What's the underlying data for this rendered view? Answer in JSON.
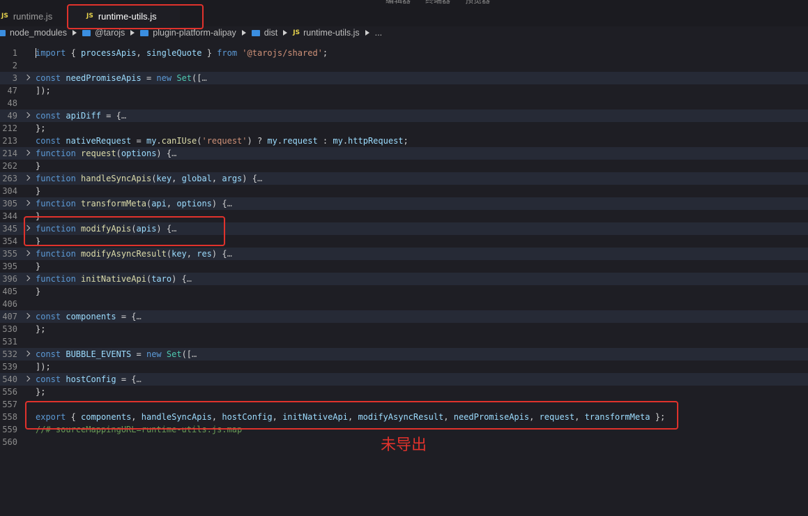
{
  "menu": [
    "编辑器",
    "终端器",
    "预览器"
  ],
  "tabs": [
    {
      "icon": "JS",
      "label": "runtime.js",
      "active": false
    },
    {
      "icon": "JS",
      "label": "runtime-utils.js",
      "active": true
    }
  ],
  "breadcrumb": [
    "node_modules",
    "@tarojs",
    "plugin-platform-alipay",
    "dist",
    "runtime-utils.js",
    "..."
  ],
  "file_icon_label": "JS",
  "lines": [
    {
      "n": "1",
      "fold": false,
      "hl": false,
      "tokens": [
        [
          "kw",
          "import"
        ],
        [
          "pl",
          " { "
        ],
        [
          "var",
          "processApis"
        ],
        [
          "pl",
          ", "
        ],
        [
          "var",
          "singleQuote"
        ],
        [
          "pl",
          " } "
        ],
        [
          "kw",
          "from"
        ],
        [
          "pl",
          " "
        ],
        [
          "str",
          "'@tarojs/shared'"
        ],
        [
          "pl",
          ";"
        ]
      ]
    },
    {
      "n": "2",
      "fold": false,
      "hl": false,
      "tokens": []
    },
    {
      "n": "3",
      "fold": true,
      "hl": true,
      "tokens": [
        [
          "kw",
          "const"
        ],
        [
          "pl",
          " "
        ],
        [
          "var",
          "needPromiseApis"
        ],
        [
          "pl",
          " = "
        ],
        [
          "kw",
          "new"
        ],
        [
          "pl",
          " "
        ],
        [
          "cls",
          "Set"
        ],
        [
          "pl",
          "(["
        ],
        [
          "ell",
          "…"
        ]
      ]
    },
    {
      "n": "47",
      "fold": false,
      "hl": false,
      "tokens": [
        [
          "pl",
          "]);"
        ]
      ]
    },
    {
      "n": "48",
      "fold": false,
      "hl": false,
      "tokens": []
    },
    {
      "n": "49",
      "fold": true,
      "hl": true,
      "tokens": [
        [
          "kw",
          "const"
        ],
        [
          "pl",
          " "
        ],
        [
          "var",
          "apiDiff"
        ],
        [
          "pl",
          " = {"
        ],
        [
          "ell",
          "…"
        ]
      ]
    },
    {
      "n": "212",
      "fold": false,
      "hl": false,
      "tokens": [
        [
          "pl",
          "};"
        ]
      ]
    },
    {
      "n": "213",
      "fold": false,
      "hl": false,
      "tokens": [
        [
          "kw",
          "const"
        ],
        [
          "pl",
          " "
        ],
        [
          "var",
          "nativeRequest"
        ],
        [
          "pl",
          " = "
        ],
        [
          "var",
          "my"
        ],
        [
          "pl",
          "."
        ],
        [
          "fn",
          "canIUse"
        ],
        [
          "pl",
          "("
        ],
        [
          "str",
          "'request'"
        ],
        [
          "pl",
          ") ? "
        ],
        [
          "var",
          "my"
        ],
        [
          "pl",
          "."
        ],
        [
          "var",
          "request"
        ],
        [
          "pl",
          " : "
        ],
        [
          "var",
          "my"
        ],
        [
          "pl",
          "."
        ],
        [
          "var",
          "httpRequest"
        ],
        [
          "pl",
          ";"
        ]
      ]
    },
    {
      "n": "214",
      "fold": true,
      "hl": true,
      "tokens": [
        [
          "kw",
          "function"
        ],
        [
          "pl",
          " "
        ],
        [
          "fn",
          "request"
        ],
        [
          "pl",
          "("
        ],
        [
          "var",
          "options"
        ],
        [
          "pl",
          ") {"
        ],
        [
          "ell",
          "…"
        ]
      ]
    },
    {
      "n": "262",
      "fold": false,
      "hl": false,
      "tokens": [
        [
          "pl",
          "}"
        ]
      ]
    },
    {
      "n": "263",
      "fold": true,
      "hl": true,
      "tokens": [
        [
          "kw",
          "function"
        ],
        [
          "pl",
          " "
        ],
        [
          "fn",
          "handleSyncApis"
        ],
        [
          "pl",
          "("
        ],
        [
          "var",
          "key"
        ],
        [
          "pl",
          ", "
        ],
        [
          "var",
          "global"
        ],
        [
          "pl",
          ", "
        ],
        [
          "var",
          "args"
        ],
        [
          "pl",
          ") {"
        ],
        [
          "ell",
          "…"
        ]
      ]
    },
    {
      "n": "304",
      "fold": false,
      "hl": false,
      "tokens": [
        [
          "pl",
          "}"
        ]
      ]
    },
    {
      "n": "305",
      "fold": true,
      "hl": true,
      "tokens": [
        [
          "kw",
          "function"
        ],
        [
          "pl",
          " "
        ],
        [
          "fn",
          "transformMeta"
        ],
        [
          "pl",
          "("
        ],
        [
          "var",
          "api"
        ],
        [
          "pl",
          ", "
        ],
        [
          "var",
          "options"
        ],
        [
          "pl",
          ") {"
        ],
        [
          "ell",
          "…"
        ]
      ]
    },
    {
      "n": "344",
      "fold": false,
      "hl": false,
      "tokens": [
        [
          "pl",
          "}"
        ]
      ]
    },
    {
      "n": "345",
      "fold": true,
      "hl": true,
      "tokens": [
        [
          "kw",
          "function"
        ],
        [
          "pl",
          " "
        ],
        [
          "fn",
          "modifyApis"
        ],
        [
          "pl",
          "("
        ],
        [
          "var",
          "apis"
        ],
        [
          "pl",
          ") {"
        ],
        [
          "ell",
          "…"
        ]
      ]
    },
    {
      "n": "354",
      "fold": false,
      "hl": false,
      "tokens": [
        [
          "pl",
          "}"
        ]
      ]
    },
    {
      "n": "355",
      "fold": true,
      "hl": true,
      "tokens": [
        [
          "kw",
          "function"
        ],
        [
          "pl",
          " "
        ],
        [
          "fn",
          "modifyAsyncResult"
        ],
        [
          "pl",
          "("
        ],
        [
          "var",
          "key"
        ],
        [
          "pl",
          ", "
        ],
        [
          "var",
          "res"
        ],
        [
          "pl",
          ") {"
        ],
        [
          "ell",
          "…"
        ]
      ]
    },
    {
      "n": "395",
      "fold": false,
      "hl": false,
      "tokens": [
        [
          "pl",
          "}"
        ]
      ]
    },
    {
      "n": "396",
      "fold": true,
      "hl": true,
      "tokens": [
        [
          "kw",
          "function"
        ],
        [
          "pl",
          " "
        ],
        [
          "fn",
          "initNativeApi"
        ],
        [
          "pl",
          "("
        ],
        [
          "var",
          "taro"
        ],
        [
          "pl",
          ") {"
        ],
        [
          "ell",
          "…"
        ]
      ]
    },
    {
      "n": "405",
      "fold": false,
      "hl": false,
      "tokens": [
        [
          "pl",
          "}"
        ]
      ]
    },
    {
      "n": "406",
      "fold": false,
      "hl": false,
      "tokens": []
    },
    {
      "n": "407",
      "fold": true,
      "hl": true,
      "tokens": [
        [
          "kw",
          "const"
        ],
        [
          "pl",
          " "
        ],
        [
          "var",
          "components"
        ],
        [
          "pl",
          " = {"
        ],
        [
          "ell",
          "…"
        ]
      ]
    },
    {
      "n": "530",
      "fold": false,
      "hl": false,
      "tokens": [
        [
          "pl",
          "};"
        ]
      ]
    },
    {
      "n": "531",
      "fold": false,
      "hl": false,
      "tokens": []
    },
    {
      "n": "532",
      "fold": true,
      "hl": true,
      "tokens": [
        [
          "kw",
          "const"
        ],
        [
          "pl",
          " "
        ],
        [
          "var",
          "BUBBLE_EVENTS"
        ],
        [
          "pl",
          " = "
        ],
        [
          "kw",
          "new"
        ],
        [
          "pl",
          " "
        ],
        [
          "cls",
          "Set"
        ],
        [
          "pl",
          "(["
        ],
        [
          "ell",
          "…"
        ]
      ]
    },
    {
      "n": "539",
      "fold": false,
      "hl": false,
      "tokens": [
        [
          "pl",
          "]);"
        ]
      ]
    },
    {
      "n": "540",
      "fold": true,
      "hl": true,
      "tokens": [
        [
          "kw",
          "const"
        ],
        [
          "pl",
          " "
        ],
        [
          "var",
          "hostConfig"
        ],
        [
          "pl",
          " = {"
        ],
        [
          "ell",
          "…"
        ]
      ]
    },
    {
      "n": "556",
      "fold": false,
      "hl": false,
      "tokens": [
        [
          "pl",
          "};"
        ]
      ]
    },
    {
      "n": "557",
      "fold": false,
      "hl": false,
      "tokens": []
    },
    {
      "n": "558",
      "fold": false,
      "hl": false,
      "tokens": [
        [
          "kw",
          "export"
        ],
        [
          "pl",
          " { "
        ],
        [
          "var",
          "components"
        ],
        [
          "pl",
          ", "
        ],
        [
          "var",
          "handleSyncApis"
        ],
        [
          "pl",
          ", "
        ],
        [
          "var",
          "hostConfig"
        ],
        [
          "pl",
          ", "
        ],
        [
          "var",
          "initNativeApi"
        ],
        [
          "pl",
          ", "
        ],
        [
          "var",
          "modifyAsyncResult"
        ],
        [
          "pl",
          ", "
        ],
        [
          "var",
          "needPromiseApis"
        ],
        [
          "pl",
          ", "
        ],
        [
          "var",
          "request"
        ],
        [
          "pl",
          ", "
        ],
        [
          "var",
          "transformMeta"
        ],
        [
          "pl",
          " };"
        ]
      ]
    },
    {
      "n": "559",
      "fold": false,
      "hl": false,
      "tokens": [
        [
          "cm",
          "//# sourceMappingURL=runtime-utils.js.map"
        ]
      ]
    },
    {
      "n": "560",
      "fold": false,
      "hl": false,
      "tokens": []
    }
  ],
  "annotation": {
    "text": "未导出",
    "color": "#e0322c"
  }
}
